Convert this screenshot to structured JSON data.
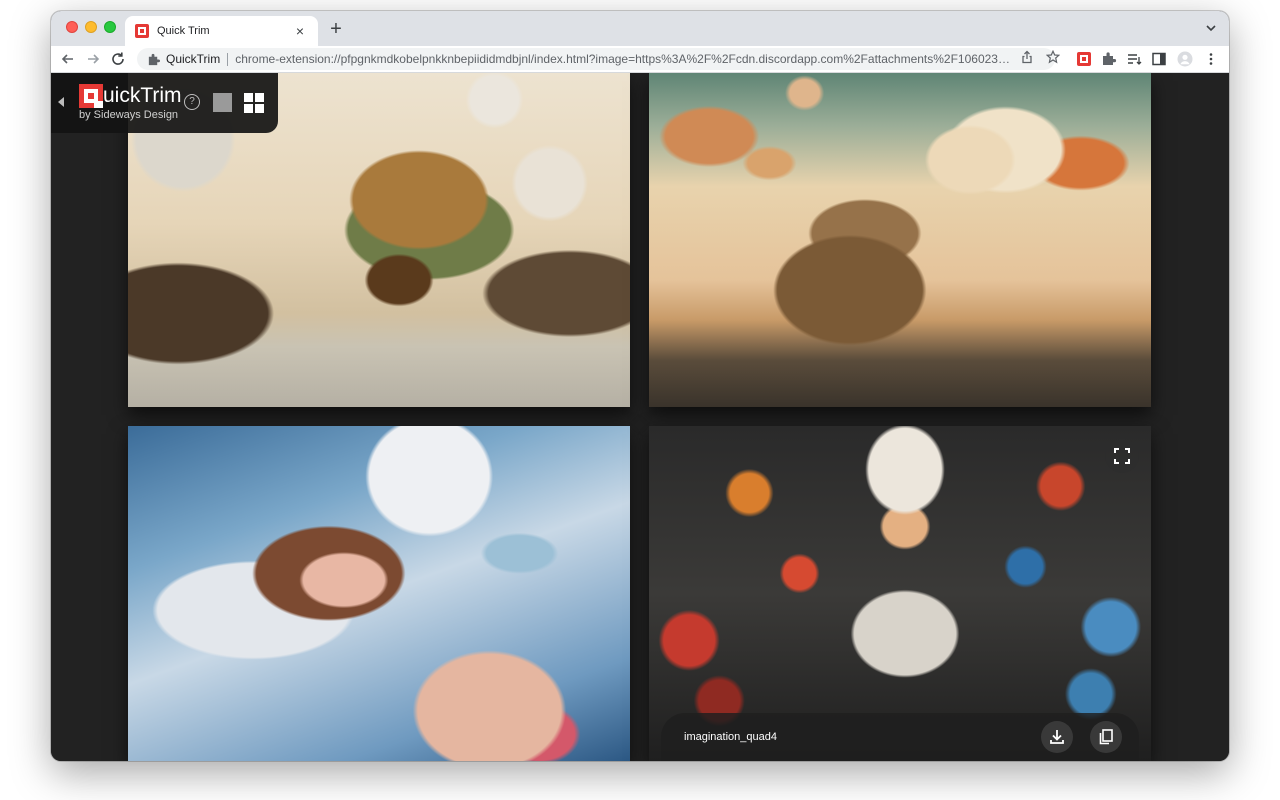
{
  "browser": {
    "tab": {
      "title": "Quick Trim",
      "favicon": "quicktrim-logo-icon"
    },
    "omnibox": {
      "site_name": "QuickTrim",
      "url": "chrome-extension://pfpgnkmdkobelpnkknbepiididmdbjnl/index.html?image=https%3A%2F%2Fcdn.discordapp.com%2Fattachments%2F10602312..."
    },
    "icons": [
      "back-icon",
      "forward-icon",
      "reload-icon",
      "share-icon",
      "bookmark-star-icon",
      "quicktrim-extension-icon",
      "extensions-puzzle-icon",
      "reading-list-icon",
      "side-panel-icon",
      "profile-avatar-icon",
      "more-menu-icon"
    ]
  },
  "app": {
    "title": "QuickTrim",
    "title_initial": "Q",
    "title_rest": "uickTrim",
    "subtitle": "by Sideways Design",
    "help_label": "?",
    "view_modes": [
      "single-view",
      "grid-view"
    ],
    "active_view": "grid-view",
    "accent_color": "#e53935"
  },
  "images": [
    {
      "id": "quad1"
    },
    {
      "id": "quad2"
    },
    {
      "id": "quad3"
    },
    {
      "id": "quad4",
      "caption": "imagination_quad4",
      "hovered": true
    }
  ]
}
